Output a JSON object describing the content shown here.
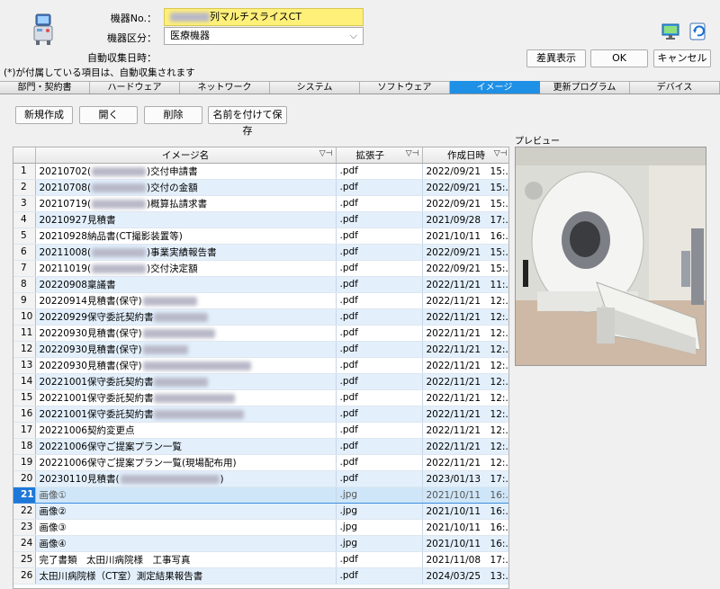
{
  "header": {
    "kiki_no_label": "機器No.：",
    "kiki_no_value": "列マルチスライスCT",
    "kiki_kubun_label": "機器区分：",
    "kiki_kubun_value": "医療機器",
    "auto_collect_label": "自動収集日時：",
    "note": "(*)が付属している項目は、自動収集されます"
  },
  "buttons": {
    "diff": "差異表示",
    "ok": "OK",
    "cancel": "キャンセル"
  },
  "tabs": [
    "部門・契約書",
    "ハードウェア",
    "ネットワーク",
    "システム",
    "ソフトウェア",
    "イメージ",
    "更新プログラム",
    "デバイス"
  ],
  "active_tab": "イメージ",
  "toolbar": {
    "new": "新規作成",
    "open": "開く",
    "delete": "削除",
    "save_as": "名前を付けて保存"
  },
  "preview_label": "プレビュー",
  "grid": {
    "columns": [
      "イメージ名",
      "拡張子",
      "作成日時"
    ],
    "rows": [
      {
        "n": "1",
        "name": "20210702(",
        "suffix": ")交付申請書",
        "ext": ".pdf",
        "date": "2022/09/21　15:…"
      },
      {
        "n": "2",
        "name": "20210708(",
        "suffix": ")交付の金額",
        "ext": ".pdf",
        "date": "2022/09/21　15:…"
      },
      {
        "n": "3",
        "name": "20210719(",
        "suffix": ")概算払請求書",
        "ext": ".pdf",
        "date": "2022/09/21　15:…"
      },
      {
        "n": "4",
        "name": "20210927見積書",
        "suffix": "",
        "ext": ".pdf",
        "date": "2021/09/28　17:…"
      },
      {
        "n": "5",
        "name": "20210928納品書(CT撮影装置等)",
        "suffix": "",
        "ext": ".pdf",
        "date": "2021/10/11　16:…"
      },
      {
        "n": "6",
        "name": "20211008(",
        "suffix": ")事業実績報告書",
        "ext": ".pdf",
        "date": "2022/09/21　15:…"
      },
      {
        "n": "7",
        "name": "20211019(",
        "suffix": ")交付決定額",
        "ext": ".pdf",
        "date": "2022/09/21　15:…"
      },
      {
        "n": "8",
        "name": "20220908稟議書",
        "suffix": "",
        "ext": ".pdf",
        "date": "2022/11/21　11:…"
      },
      {
        "n": "9",
        "name": "20220914見積書(保守)",
        "suffix": "",
        "ext": ".pdf",
        "date": "2022/11/21　12:…"
      },
      {
        "n": "10",
        "name": "20220929保守委託契約書",
        "suffix": "",
        "ext": ".pdf",
        "date": "2022/11/21　12:…"
      },
      {
        "n": "11",
        "name": "20220930見積書(保守)",
        "suffix": "",
        "ext": ".pdf",
        "date": "2022/11/21　12:…"
      },
      {
        "n": "12",
        "name": "20220930見積書(保守)",
        "suffix": "",
        "ext": ".pdf",
        "date": "2022/11/21　12:…"
      },
      {
        "n": "13",
        "name": "20220930見積書(保守)",
        "suffix": "",
        "ext": ".pdf",
        "date": "2022/11/21　12:…"
      },
      {
        "n": "14",
        "name": "20221001保守委託契約書",
        "suffix": "",
        "ext": ".pdf",
        "date": "2022/11/21　12:…"
      },
      {
        "n": "15",
        "name": "20221001保守委託契約書",
        "suffix": "",
        "ext": ".pdf",
        "date": "2022/11/21　12:…"
      },
      {
        "n": "16",
        "name": "20221001保守委託契約書",
        "suffix": "",
        "ext": ".pdf",
        "date": "2022/11/21　12:…"
      },
      {
        "n": "17",
        "name": "20221006契約変更点",
        "suffix": "",
        "ext": ".pdf",
        "date": "2022/11/21　12:…"
      },
      {
        "n": "18",
        "name": "20221006保守ご提案プラン一覧",
        "suffix": "",
        "ext": ".pdf",
        "date": "2022/11/21　12:…"
      },
      {
        "n": "19",
        "name": "20221006保守ご提案プラン一覧(現場配布用)",
        "suffix": "",
        "ext": ".pdf",
        "date": "2022/11/21　12:…"
      },
      {
        "n": "20",
        "name": "20230110見積書(",
        "suffix": ")",
        "ext": ".pdf",
        "date": "2023/01/13　17:…"
      },
      {
        "n": "21",
        "name": "画像①",
        "suffix": "",
        "ext": ".jpg",
        "date": "2021/10/11　16:…"
      },
      {
        "n": "22",
        "name": "画像②",
        "suffix": "",
        "ext": ".jpg",
        "date": "2021/10/11　16:…"
      },
      {
        "n": "23",
        "name": "画像③",
        "suffix": "",
        "ext": ".jpg",
        "date": "2021/10/11　16:…"
      },
      {
        "n": "24",
        "name": "画像④",
        "suffix": "",
        "ext": ".jpg",
        "date": "2021/10/11　16:…"
      },
      {
        "n": "25",
        "name": "完了書類　太田川病院様　工事写真",
        "suffix": "",
        "ext": ".pdf",
        "date": "2021/11/08　17:…"
      },
      {
        "n": "26",
        "name": "太田川病院様（CT室）測定結果報告書",
        "suffix": "",
        "ext": ".pdf",
        "date": "2024/03/25　13:…"
      }
    ],
    "selected_row": "21",
    "blur_rows": [
      "1",
      "2",
      "3",
      "6",
      "7",
      "9",
      "10",
      "11",
      "12",
      "13",
      "14",
      "15",
      "16",
      "20"
    ]
  },
  "colors": {
    "accent": "#1e90e6",
    "highlight": "#fff07a",
    "row_alt": "#e3f0fc"
  }
}
